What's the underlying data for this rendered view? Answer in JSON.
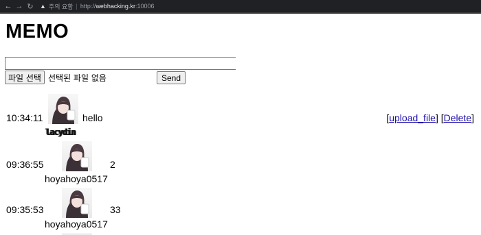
{
  "browser": {
    "back_icon": "arrow-left-icon",
    "forward_icon": "arrow-right-icon",
    "reload_icon": "reload-icon",
    "security_icon": "warning-triangle-icon",
    "security_label": "주의 요함",
    "separator": "|",
    "url_prefix": "http://",
    "url_host": "webhacking.kr",
    "url_port": ":10006"
  },
  "page": {
    "title": "MEMO"
  },
  "form": {
    "memo_value": "",
    "file_button_label": "파일 선택",
    "file_status": "선택된 파일 없음",
    "send_label": "Send"
  },
  "memos": [
    {
      "time": "10:34:11",
      "text": "hello",
      "user": "lacydin"
    },
    {
      "time": "09:36:55",
      "text": "2",
      "user": "hoyahoya0517"
    },
    {
      "time": "09:35:53",
      "text": "33",
      "user": "hoyahoya0517"
    }
  ],
  "actions": {
    "upload_label": "upload_file",
    "delete_label": "Delete",
    "bracket_open": "[",
    "bracket_close": "]"
  },
  "colors": {
    "topbar": "#202124",
    "link": "#1a0dab"
  }
}
